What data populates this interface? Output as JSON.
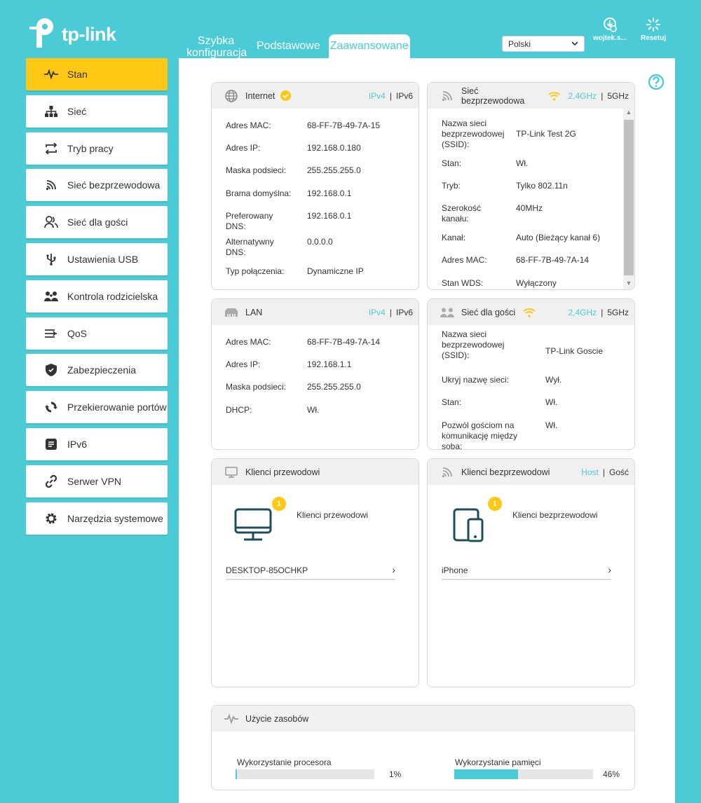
{
  "brand": {
    "name": "tp-link"
  },
  "top_tabs": [
    {
      "label": "Szybka konfiguracja"
    },
    {
      "label": "Podstawowe"
    },
    {
      "label": "Zaawansowane"
    }
  ],
  "language": {
    "selected": "Polski"
  },
  "header_buttons": {
    "user": "wojtek.s...",
    "reset": "Resetuj"
  },
  "sidebar": {
    "items": [
      {
        "label": "Stan",
        "icon": "pulse-icon"
      },
      {
        "label": "Sieć",
        "icon": "network-icon"
      },
      {
        "label": "Tryb pracy",
        "icon": "swap-icon"
      },
      {
        "label": "Sieć bezprzewodowa",
        "icon": "wifi-icon"
      },
      {
        "label": "Sieć dla gości",
        "icon": "guests-icon"
      },
      {
        "label": "Ustawienia USB",
        "icon": "usb-icon"
      },
      {
        "label": "Kontrola rodzicielska",
        "icon": "parental-icon"
      },
      {
        "label": "QoS",
        "icon": "qos-icon"
      },
      {
        "label": "Zabezpieczenia",
        "icon": "shield-icon"
      },
      {
        "label": "Przekierowanie portów",
        "icon": "forwarding-icon"
      },
      {
        "label": "IPv6",
        "icon": "ipv6-icon"
      },
      {
        "label": "Serwer VPN",
        "icon": "link-icon"
      },
      {
        "label": "Narzędzia systemowe",
        "icon": "gear-icon"
      }
    ]
  },
  "internet": {
    "title": "Internet",
    "ipv4": "IPv4",
    "ipv6": "IPv6",
    "rows": [
      {
        "k": "Adres MAC:",
        "v": "68-FF-7B-49-7A-15"
      },
      {
        "k": "Adres IP:",
        "v": "192.168.0.180"
      },
      {
        "k": "Maska podsieci:",
        "v": "255.255.255.0"
      },
      {
        "k": "Brama domyślna:",
        "v": "192.168.0.1"
      },
      {
        "k": "Preferowany DNS:",
        "v": "192.168.0.1"
      },
      {
        "k": "Alternatywny DNS:",
        "v": "0.0.0.0"
      },
      {
        "k": "Typ połączenia:",
        "v": "Dynamiczne IP"
      }
    ]
  },
  "wireless": {
    "title": "Sieć bezprzewodowa",
    "band24": "2,4GHz",
    "band5": "5GHz",
    "rows": [
      {
        "k": "Nazwa sieci bezprzewodowej (SSID):",
        "v": "TP-Link Test 2G"
      },
      {
        "k": "Stan:",
        "v": "Wł."
      },
      {
        "k": "Tryb:",
        "v": "Tylko 802.11n"
      },
      {
        "k": "Szerokość kanału:",
        "v": "40MHz"
      },
      {
        "k": "Kanał:",
        "v": "Auto (Bieżący kanał 6)"
      },
      {
        "k": "Adres MAC:",
        "v": "68-FF-7B-49-7A-14"
      },
      {
        "k": "Stan WDS:",
        "v": "Wyłączony"
      }
    ]
  },
  "lan": {
    "title": "LAN",
    "ipv4": "IPv4",
    "ipv6": "IPv6",
    "rows": [
      {
        "k": "Adres MAC:",
        "v": "68-FF-7B-49-7A-14"
      },
      {
        "k": "Adres IP:",
        "v": "192.168.1.1"
      },
      {
        "k": "Maska podsieci:",
        "v": "255.255.255.0"
      },
      {
        "k": "DHCP:",
        "v": "Wł."
      }
    ]
  },
  "guest": {
    "title": "Sieć dla gości",
    "band24": "2,4GHz",
    "band5": "5GHz",
    "rows": [
      {
        "k": "Nazwa sieci bezprzewodowej (SSID):",
        "v": "TP-Link Goscie"
      },
      {
        "k": "Ukryj nazwę sieci:",
        "v": "Wył."
      },
      {
        "k": "Stan:",
        "v": "Wł."
      },
      {
        "k": "Pozwól gościom na komunikację między sobą:",
        "v": "Wł."
      }
    ]
  },
  "wired_clients": {
    "title": "Klienci przewodowi",
    "count": "1",
    "label": "Klienci przewodowi",
    "device": "DESKTOP-85OCHKP"
  },
  "wireless_clients": {
    "title": "Klienci bezprzewodowi",
    "host": "Host",
    "guest": "Gość",
    "count": "1",
    "label": "Klienci bezprzewodowi",
    "device": "iPhone"
  },
  "resources": {
    "title": "Użycie zasobów",
    "cpu_label": "Wykorzystanie procesora",
    "cpu_text": "1%",
    "cpu": 1,
    "mem_label": "Wykorzystanie pamięci",
    "mem_text": "46%",
    "mem": 46
  },
  "colors": {
    "accent": "#4acbd6",
    "active": "#ffc815"
  }
}
